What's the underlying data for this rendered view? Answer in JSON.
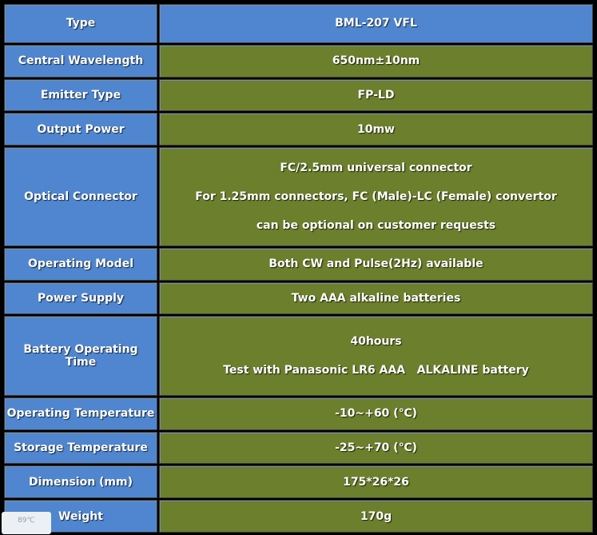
{
  "table": {
    "rows": [
      {
        "label": "Type",
        "value": [
          "BML-207 VFL"
        ]
      },
      {
        "label": "Central Wavelength",
        "value": [
          "650nm±10nm"
        ]
      },
      {
        "label": "Emitter Type",
        "value": [
          "FP-LD"
        ]
      },
      {
        "label": "Output Power",
        "value": [
          "10mw"
        ]
      },
      {
        "label": "Optical Connector",
        "value": [
          "FC/2.5mm universal connector",
          "For 1.25mm connectors, FC (Male)-LC (Female) convertor",
          "can be optional on customer requests"
        ]
      },
      {
        "label": "Operating Model",
        "value": [
          "Both CW and Pulse(2Hz) available"
        ]
      },
      {
        "label": "Power Supply",
        "value": [
          "Two AAA alkaline batteries"
        ]
      },
      {
        "label": "Battery Operating Time",
        "value": [
          "40hours",
          "Test with Panasonic LR6 AAA   ALKALINE battery"
        ]
      },
      {
        "label": "Operating Temperature",
        "value": [
          "-10~+60 (℃)"
        ]
      },
      {
        "label": "Storage Temperature",
        "value": [
          "-25~+70 (℃)"
        ]
      },
      {
        "label": "Dimension (mm)",
        "value": [
          "175*26*26"
        ]
      },
      {
        "label": "Weight",
        "value": [
          "170g"
        ]
      }
    ]
  },
  "overlay": {
    "temperature_badge": "89℃"
  }
}
